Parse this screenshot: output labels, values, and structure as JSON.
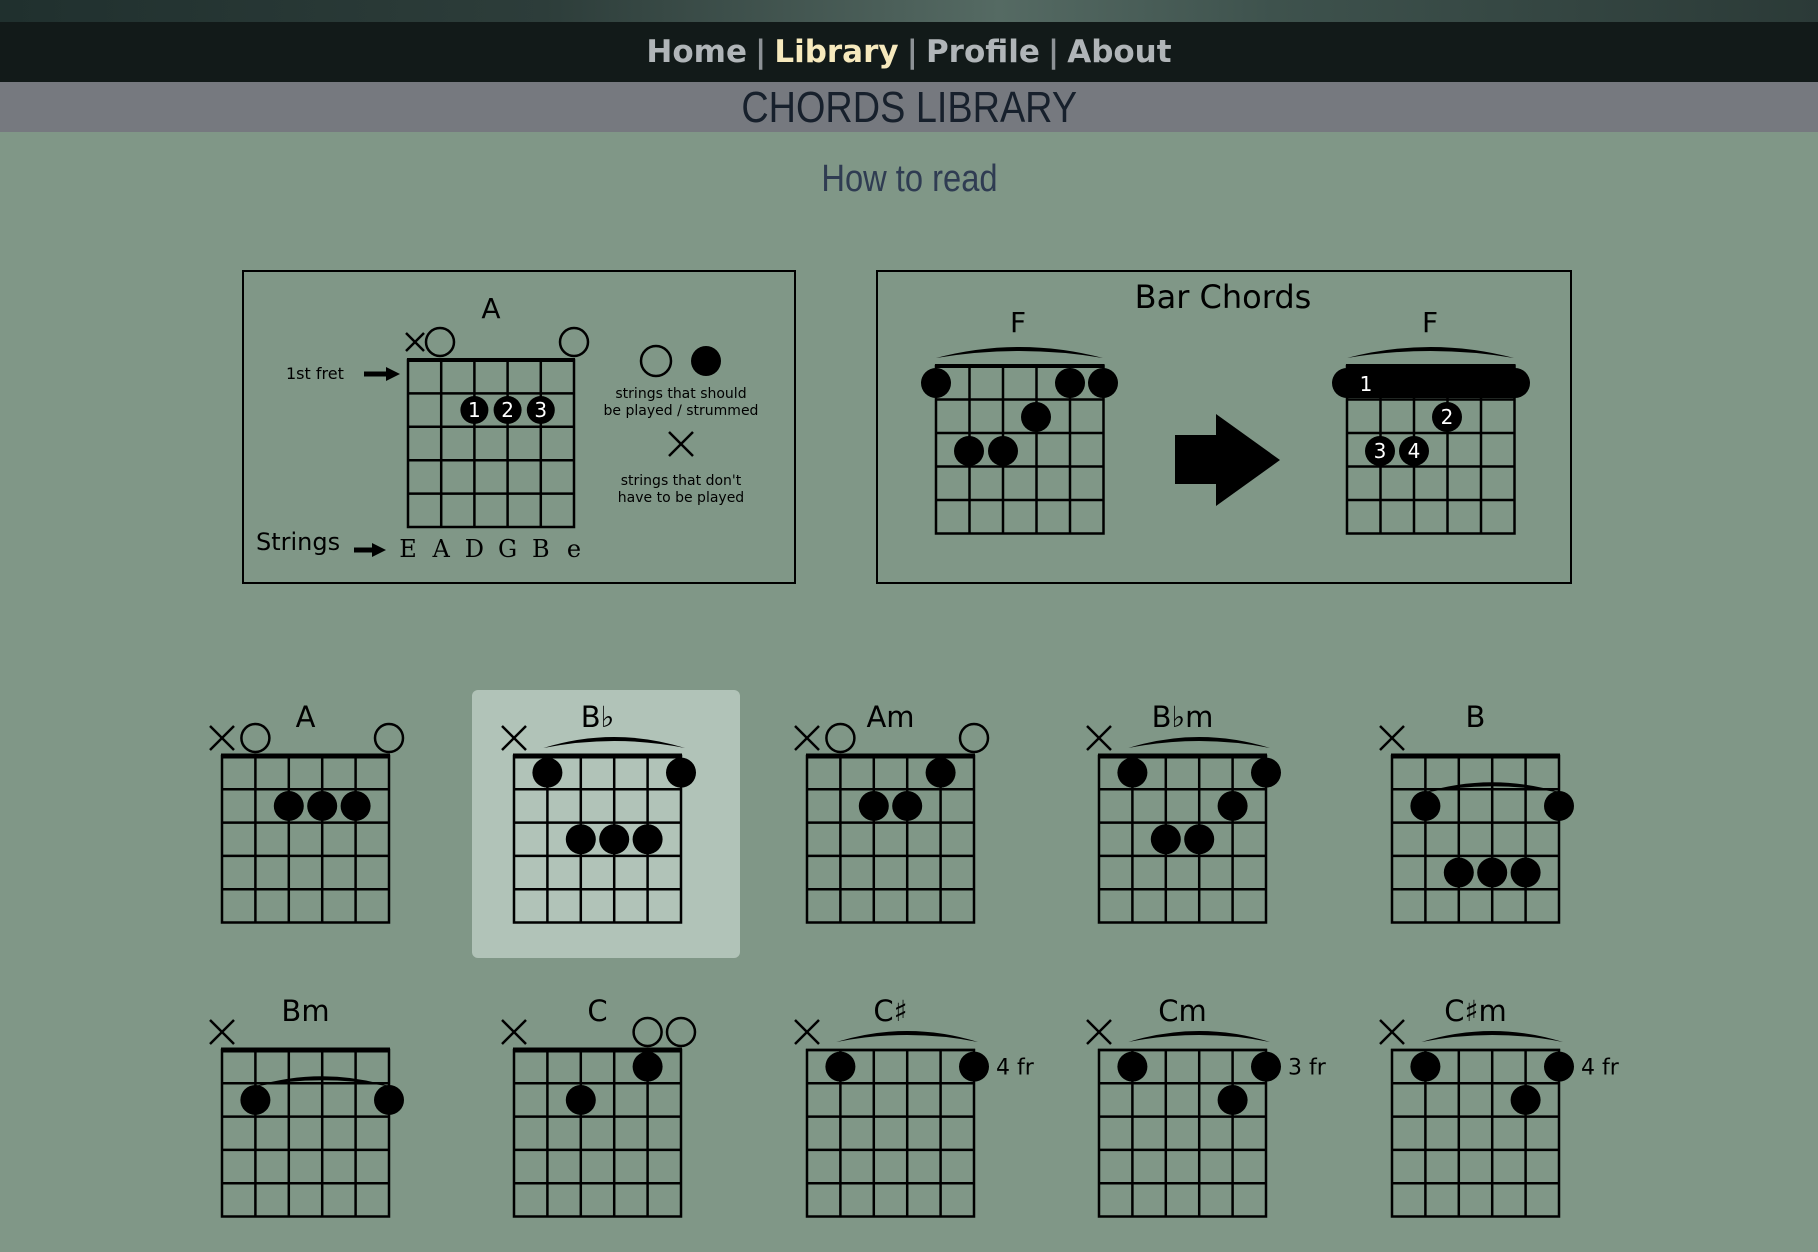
{
  "nav": {
    "items": [
      {
        "label": "Home",
        "active": false
      },
      {
        "label": "Library",
        "active": true
      },
      {
        "label": "Profile",
        "active": false
      },
      {
        "label": "About",
        "active": false
      }
    ],
    "separator": "|"
  },
  "page_title": "CHORDS LIBRARY",
  "section_title": "How to read",
  "legend": {
    "chord_name": "A",
    "first_fret_label": "1st fret",
    "strings_label": "Strings",
    "string_names": [
      "E",
      "A",
      "D",
      "G",
      "B",
      "e"
    ],
    "played_text": [
      "strings that should",
      "be played / strummed"
    ],
    "muted_text": [
      "strings that don't",
      "have to be played"
    ],
    "finger_numbers": [
      "1",
      "2",
      "3"
    ]
  },
  "bar_chords": {
    "title": "Bar Chords",
    "left_chord": "F",
    "right_chord": "F",
    "finger_numbers": [
      "1",
      "2",
      "3",
      "4"
    ]
  },
  "chords": [
    {
      "name": "A",
      "selected": false
    },
    {
      "name": "B♭",
      "selected": true
    },
    {
      "name": "Am",
      "selected": false
    },
    {
      "name": "B♭m",
      "selected": false
    },
    {
      "name": "B",
      "selected": false
    },
    {
      "name": "Bm",
      "selected": false
    },
    {
      "name": "C",
      "selected": false
    },
    {
      "name": "C♯",
      "selected": false,
      "fret_label": "4 fr"
    },
    {
      "name": "Cm",
      "selected": false,
      "fret_label": "3 fr"
    },
    {
      "name": "C♯m",
      "selected": false,
      "fret_label": "4 fr"
    }
  ]
}
